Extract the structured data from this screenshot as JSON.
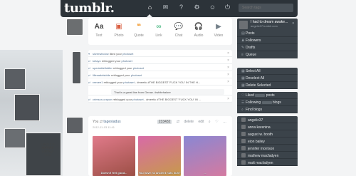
{
  "header": {
    "logo": "tumblr.",
    "search_placeholder": "Search tags",
    "nav_icons": [
      "home-icon",
      "mail-icon",
      "help-icon",
      "gear-icon",
      "person-icon",
      "power-icon"
    ]
  },
  "background_text": {
    "line1": "I WOULD",
    "line2": "never",
    "line3": "BETRAY YOU"
  },
  "post_types": [
    {
      "label": "Text",
      "glyph": "Aa",
      "color": "#444444"
    },
    {
      "label": "Photo",
      "glyph": "▣",
      "color": "#d95e40"
    },
    {
      "label": "Quote",
      "glyph": "❝",
      "color": "#f2992e"
    },
    {
      "label": "Link",
      "glyph": "∞",
      "color": "#56bc8a"
    },
    {
      "label": "Chat",
      "glyph": "💬",
      "color": "#529ecc"
    },
    {
      "label": "Audio",
      "glyph": "🎧",
      "color": "#a77dc2"
    },
    {
      "label": "Video",
      "glyph": "▶",
      "color": "#748089"
    }
  ],
  "activity": [
    {
      "user": "silverwindow",
      "action": "liked your",
      "target": "photoset",
      "quote": ""
    },
    {
      "user": "kelayo",
      "action": "reblogged your",
      "target": "photoset",
      "quote": ""
    },
    {
      "user": "speciablefiddler",
      "action": "reblogged your",
      "target": "photoset",
      "quote": ""
    },
    {
      "user": "lillesadelsidde",
      "action": "reblogged your",
      "target": "photoset",
      "quote": ""
    },
    {
      "user": "reevee1",
      "action": "reblogged your",
      "target": "photoset",
      "quote": "- #meetic #THE BIGGEST 'FUCK YOU' IN THE H..."
    },
    {
      "user": "crimson-crayon",
      "action": "reblogged your",
      "target": "photoset",
      "quote": "- #meetic #THE BIGGEST 'FUCK YOU' IN ..."
    }
  ],
  "reply": "That is a great line from Genaz. #whitehalore",
  "post": {
    "author_you": "You",
    "author_reblog": "tagesiadus",
    "date": "2012-11-03 11:41",
    "tag": "233432",
    "tools": [
      "⇄",
      "delete",
      "edit",
      "⌕",
      "♡",
      "…"
    ],
    "gifs": [
      {
        "caption": "Doesn't feel good...",
        "color1": "#e07a8a",
        "color2": "#9c4f45"
      },
      {
        "caption": "You have no ancient nuts huh?",
        "color1": "#d86aa7",
        "color2": "#c79a4a"
      },
      {
        "caption": "...",
        "color1": "#8a87d3",
        "color2": "#d47aa0"
      }
    ]
  },
  "sidebar": {
    "blog_title": "I had to dream awake...",
    "blog_sub": "angelic37.tumblr.com",
    "blog_links": [
      {
        "icon": "▤",
        "label": "Posts"
      },
      {
        "icon": "♟",
        "label": "Followers"
      },
      {
        "icon": "✎",
        "label": "Drafts"
      },
      {
        "icon": "≡",
        "label": "Queue"
      }
    ],
    "select_links": [
      {
        "icon": "▦",
        "label": "Select All"
      },
      {
        "icon": "▦",
        "label": "Deselect All"
      },
      {
        "icon": "▦",
        "label": "Delete Selected"
      }
    ],
    "stats": [
      {
        "icon": "♡",
        "before": "Liked",
        "after": "posts"
      },
      {
        "icon": "☷",
        "before": "Following",
        "after": "blogs"
      },
      {
        "icon": "⌕",
        "before": "Find blogs",
        "after": ""
      }
    ],
    "following": [
      "angelic37",
      "anna karenina",
      "august w. booth",
      "eion bailey",
      "jennifer morrison",
      "mathew macfadyen",
      "matt macfadyen"
    ]
  }
}
